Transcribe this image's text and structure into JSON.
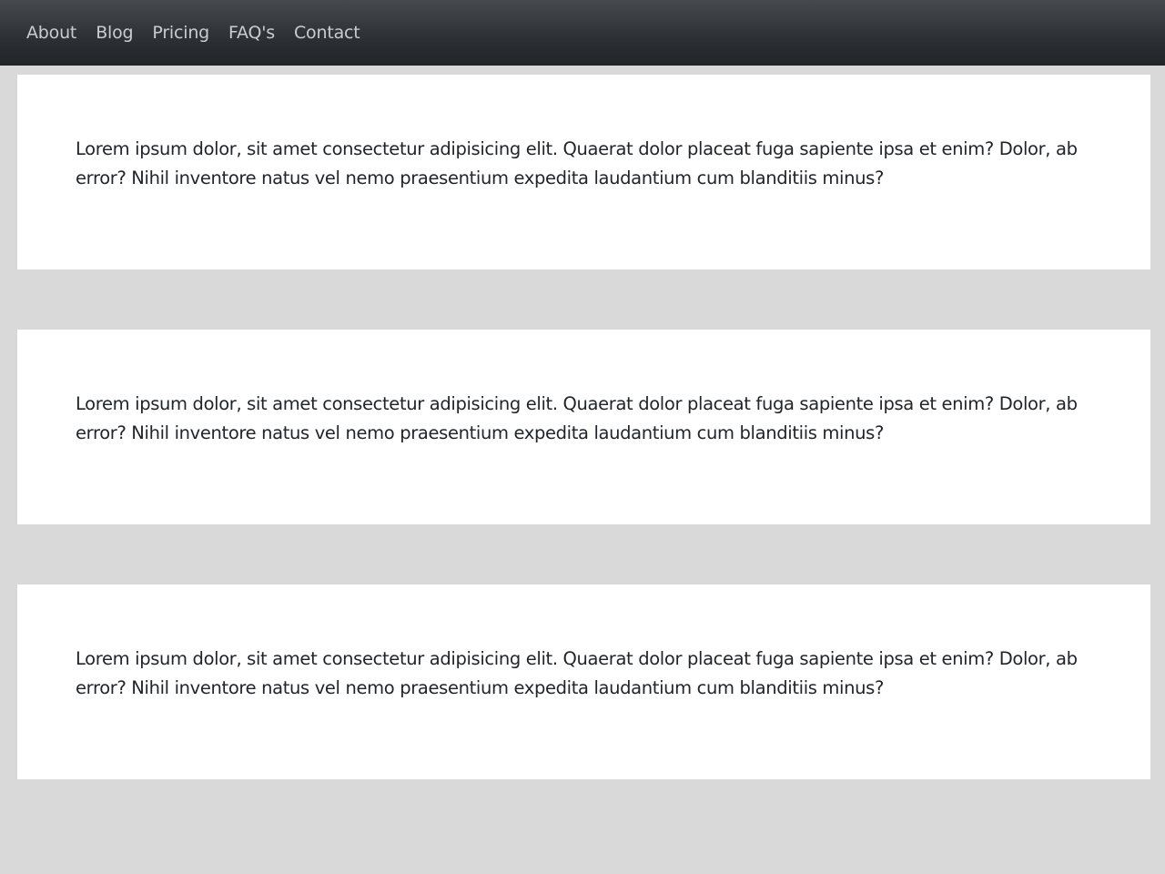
{
  "nav": {
    "items": [
      {
        "label": "About"
      },
      {
        "label": "Blog"
      },
      {
        "label": "Pricing"
      },
      {
        "label": "FAQ's"
      },
      {
        "label": "Contact"
      }
    ]
  },
  "cards": [
    {
      "text": "Lorem ipsum dolor, sit amet consectetur adipisicing elit. Quaerat dolor placeat fuga sapiente ipsa et enim? Dolor, ab error? Nihil inventore natus vel nemo praesentium expedita laudantium cum blanditiis minus?"
    },
    {
      "text": "Lorem ipsum dolor, sit amet consectetur adipisicing elit. Quaerat dolor placeat fuga sapiente ipsa et enim? Dolor, ab error? Nihil inventore natus vel nemo praesentium expedita laudantium cum blanditiis minus?"
    },
    {
      "text": "Lorem ipsum dolor, sit amet consectetur adipisicing elit. Quaerat dolor placeat fuga sapiente ipsa et enim? Dolor, ab error? Nihil inventore natus vel nemo praesentium expedita laudantium cum blanditiis minus?"
    }
  ],
  "colors": {
    "navbar": "#2c3034",
    "nav_link": "#c9cdd1",
    "page_background": "#d9d9d9",
    "card_background": "#ffffff",
    "body_text": "#212529"
  }
}
